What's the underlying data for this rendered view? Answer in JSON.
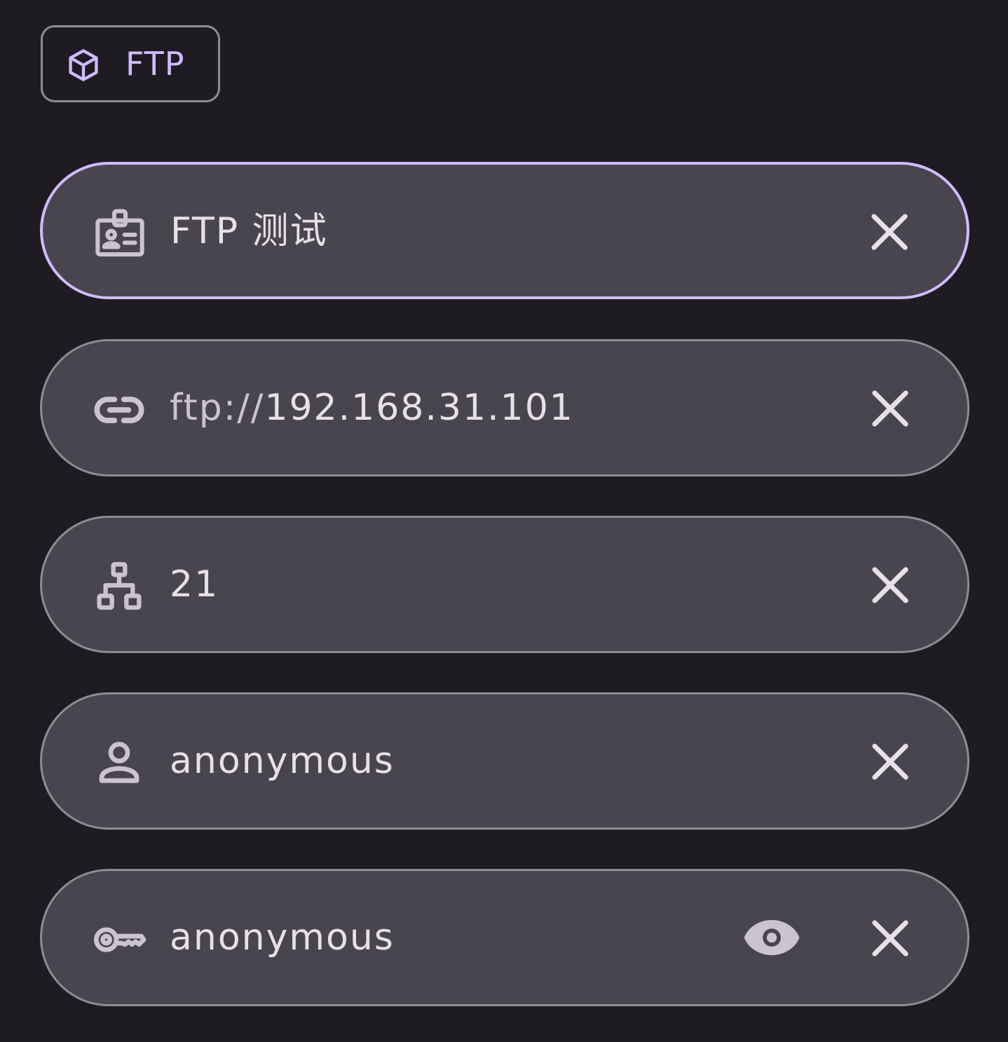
{
  "protocol_chip": {
    "label": "FTP",
    "icon": "cube-icon"
  },
  "fields": {
    "name": {
      "icon": "badge-icon",
      "value": "FTP 测试",
      "clear_icon": "close-icon"
    },
    "host": {
      "icon": "link-icon",
      "prefix": "ftp://",
      "value": "192.168.31.101",
      "clear_icon": "close-icon"
    },
    "port": {
      "icon": "network-tree-icon",
      "value": "21",
      "clear_icon": "close-icon"
    },
    "username": {
      "icon": "person-icon",
      "value": "anonymous",
      "clear_icon": "close-icon"
    },
    "password": {
      "icon": "key-icon",
      "value": "anonymous",
      "visibility_icon": "eye-icon",
      "clear_icon": "close-icon"
    }
  },
  "colors": {
    "background": "#1e1c22",
    "field_fill": "#49454f",
    "outline": "#8f8b94",
    "focus_outline": "#cfbcff",
    "accent": "#cfbcff",
    "text": "#e6e0e9",
    "icon": "#cac4d0"
  }
}
